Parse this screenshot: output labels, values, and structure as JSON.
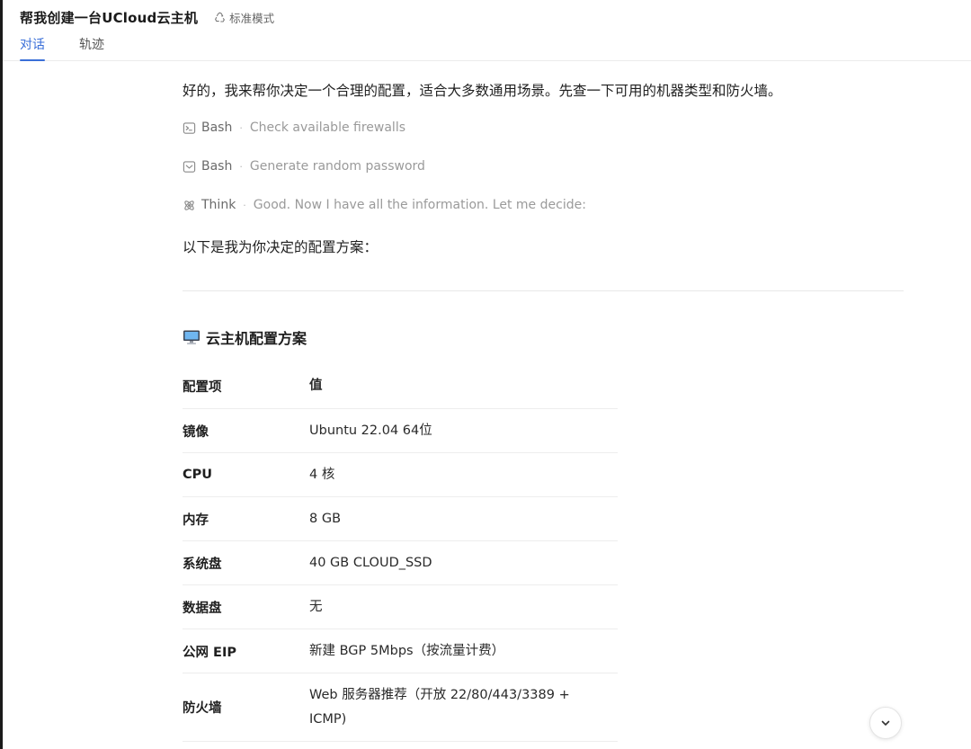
{
  "header": {
    "title": "帮我创建一台UCloud云主机",
    "mode_label": "标准模式",
    "tabs": [
      {
        "label": "对话",
        "active": true
      },
      {
        "label": "轨迹",
        "active": false
      }
    ]
  },
  "conversation": {
    "intro": "好的，我来帮你决定一个合理的配置，适合大多数通用场景。先查一下可用的机器类型和防火墙。",
    "steps": [
      {
        "icon": "terminal-icon",
        "tool": "Bash",
        "separator": "·",
        "desc": "Check available firewalls"
      },
      {
        "icon": "chevron-box-icon",
        "tool": "Bash",
        "separator": "·",
        "desc": "Generate random password"
      },
      {
        "icon": "atom-icon",
        "tool": "Think",
        "separator": "·",
        "desc": "Good. Now I have all the information. Let me decide:"
      }
    ],
    "plan_intro": "以下是我为你决定的配置方案："
  },
  "plan": {
    "section_icon": "desktop-computer-icon",
    "section_title": "云主机配置方案",
    "columns": [
      "配置项",
      "值"
    ],
    "rows": [
      {
        "key": "镜像",
        "value": "Ubuntu 22.04 64位"
      },
      {
        "key": "CPU",
        "value": "4 核"
      },
      {
        "key": "内存",
        "value": "8 GB"
      },
      {
        "key": "系统盘",
        "value": "40 GB CLOUD_SSD"
      },
      {
        "key": "数据盘",
        "value": "无"
      },
      {
        "key": "公网 EIP",
        "value": "新建 BGP 5Mbps（按流量计费）"
      },
      {
        "key": "防火墙",
        "value": "Web 服务器推荐（开放 22/80/443/3389 + ICMP)"
      }
    ]
  },
  "controls": {
    "scroll_icon": "chevron-down-icon"
  },
  "colors": {
    "accent": "#3a6fd8",
    "muted": "#9a9a9a",
    "divider": "#e8e8e8"
  }
}
